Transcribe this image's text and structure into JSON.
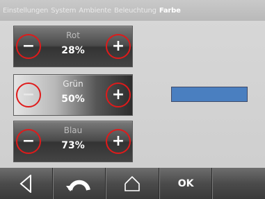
{
  "breadcrumb": [
    "Einstellungen",
    "System",
    "Ambiente",
    "Beleuchtung",
    "Farbe"
  ],
  "sliders": [
    {
      "name": "Rot",
      "value": "28%",
      "minus": "−",
      "plus": "+"
    },
    {
      "name": "Grün",
      "value": "50%",
      "minus": "−",
      "plus": "+"
    },
    {
      "name": "Blau",
      "value": "73%",
      "minus": "−",
      "plus": "+"
    }
  ],
  "preview": {
    "color": "#4a7fc0"
  },
  "nav": {
    "back_icon": "triangle-left-icon",
    "undo_icon": "curved-arrow-icon",
    "home_icon": "home-icon",
    "ok_label": "OK"
  }
}
